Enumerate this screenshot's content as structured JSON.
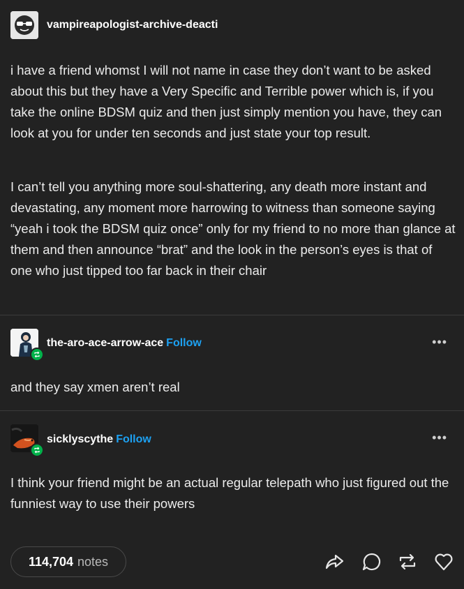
{
  "op": {
    "username": "vampireapologist-archive-deacti",
    "paragraphs": [
      "i have a friend whomst I will not name in case they don’t want to be asked about this but they have a Very Specific and Terrible power which is, if you take the online BDSM quiz and then just simply mention you have, they can look at you for under ten seconds and just state your top result.",
      "I can’t tell you anything more soul-shattering, any death more instant and devastating, any moment more harrowing to witness than someone saying “yeah i took the BDSM quiz once” only for my friend to no more than glance at them and then announce “brat” and the look in the person’s eyes is that of one who just tipped too far back in their chair"
    ]
  },
  "reblog1": {
    "username": "the-aro-ace-arrow-ace",
    "follow_label": "Follow",
    "more_label": "•••",
    "text": "and they say xmen aren’t real"
  },
  "reblog2": {
    "username": "sicklyscythe",
    "follow_label": "Follow",
    "more_label": "•••",
    "text": "I think your friend might be an actual regular telepath who just figured out the funniest way to use their powers"
  },
  "footer": {
    "notes_count": "114,704",
    "notes_label": "notes",
    "actions": [
      "share-icon",
      "reply-icon",
      "reblog-icon",
      "like-icon"
    ]
  },
  "colors": {
    "background": "#222222",
    "link_blue": "#1da1f2",
    "reblog_green": "#00b24a"
  }
}
